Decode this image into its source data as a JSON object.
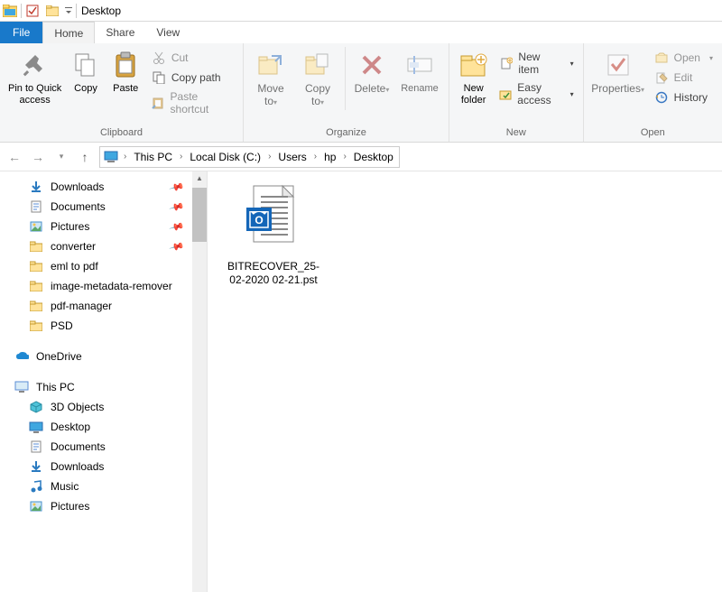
{
  "titlebar": {
    "title": "Desktop"
  },
  "tabs": {
    "file": "File",
    "home": "Home",
    "share": "Share",
    "view": "View"
  },
  "ribbon": {
    "clipboard": {
      "label": "Clipboard",
      "pin": "Pin to Quick access",
      "copy": "Copy",
      "paste": "Paste",
      "cut": "Cut",
      "copy_path": "Copy path",
      "paste_shortcut": "Paste shortcut"
    },
    "organize": {
      "label": "Organize",
      "move_to": "Move to",
      "copy_to": "Copy to",
      "delete": "Delete",
      "rename": "Rename"
    },
    "new": {
      "label": "New",
      "new_folder": "New folder",
      "new_item": "New item",
      "easy_access": "Easy access"
    },
    "open": {
      "label": "Open",
      "properties": "Properties",
      "open": "Open",
      "edit": "Edit",
      "history": "History"
    }
  },
  "breadcrumb": {
    "segments": [
      "This PC",
      "Local Disk (C:)",
      "Users",
      "hp",
      "Desktop"
    ]
  },
  "sidebar": {
    "items": [
      {
        "label": "Downloads",
        "icon": "download-blue",
        "pinned": true
      },
      {
        "label": "Documents",
        "icon": "document",
        "pinned": true
      },
      {
        "label": "Pictures",
        "icon": "pictures",
        "pinned": true
      },
      {
        "label": "converter",
        "icon": "folder",
        "pinned": true
      },
      {
        "label": "eml to pdf",
        "icon": "folder",
        "pinned": false
      },
      {
        "label": "image-metadata-remover",
        "icon": "folder",
        "pinned": false
      },
      {
        "label": "pdf-manager",
        "icon": "folder",
        "pinned": false
      },
      {
        "label": "PSD",
        "icon": "folder",
        "pinned": false
      }
    ],
    "onedrive": "OneDrive",
    "thispc": "This PC",
    "pc_children": [
      {
        "label": "3D Objects",
        "icon": "objects3d"
      },
      {
        "label": "Desktop",
        "icon": "desktop"
      },
      {
        "label": "Documents",
        "icon": "document"
      },
      {
        "label": "Downloads",
        "icon": "download-blue"
      },
      {
        "label": "Music",
        "icon": "music"
      },
      {
        "label": "Pictures",
        "icon": "pictures"
      }
    ]
  },
  "content": {
    "file_name": "BITRECOVER_25-02-2020 02-21.pst"
  }
}
